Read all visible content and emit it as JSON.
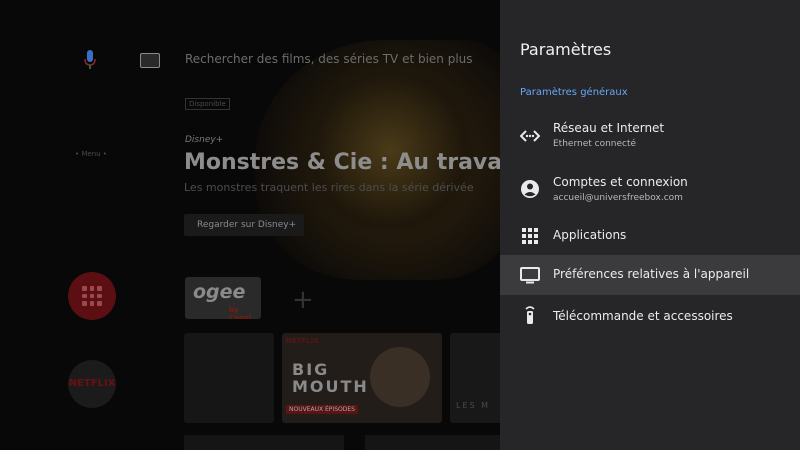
{
  "background": {
    "search_placeholder": "Rechercher des films, des séries TV et bien plus",
    "tag": "Disponible",
    "brand": "Disney+",
    "hero_title": "Monstres & Cie : Au travail",
    "hero_subtitle": "Les monstres traquent les rires dans la série dérivée",
    "watch_button": "Regarder sur Disney+",
    "menu_label": "• Menu •",
    "apps": {
      "ogee_logo": "ogee",
      "ogee_sub": "by Canal",
      "netflix": "NETFLIX"
    },
    "thumbs": {
      "netflix_tag": "NETFLIX",
      "big_mouth": [
        "BIG",
        "MOUTH"
      ],
      "episode_badge": "NOUVEAUX ÉPISODES",
      "thumb3_text": "LES M"
    }
  },
  "settings": {
    "title": "Paramètres",
    "section": "Paramètres généraux",
    "items": [
      {
        "icon": "network-icon",
        "label": "Réseau et Internet",
        "sub": "Ethernet connecté",
        "focused": false
      },
      {
        "icon": "account-icon",
        "label": "Comptes et connexion",
        "sub": "accueil@universfreebox.com",
        "focused": false
      },
      {
        "icon": "apps-grid-icon",
        "label": "Applications",
        "sub": "",
        "focused": false
      },
      {
        "icon": "tv-icon",
        "label": "Préférences relatives à l'appareil",
        "sub": "",
        "focused": true
      },
      {
        "icon": "remote-icon",
        "label": "Télécommande et accessoires",
        "sub": "",
        "focused": false
      }
    ]
  },
  "colors": {
    "panel_bg": "#262628",
    "focused_bg": "#3b3b3d",
    "section_accent": "#6aa6f5",
    "text_primary": "#ececec",
    "text_secondary": "#b8b8b8"
  }
}
